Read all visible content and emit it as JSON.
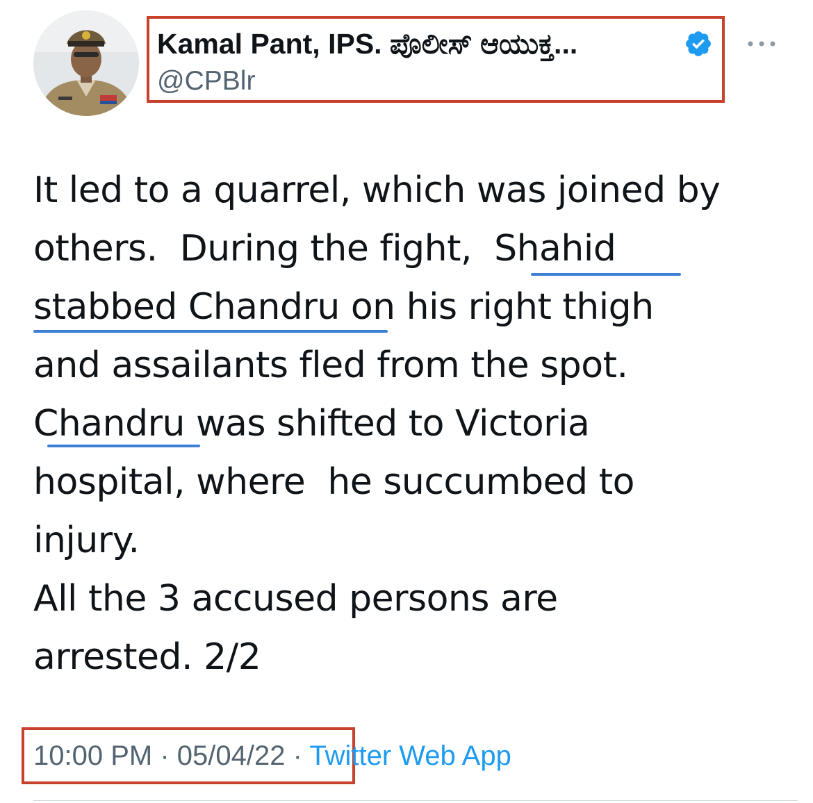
{
  "tweet": {
    "author": {
      "display_name": "Kamal Pant, IPS. ಪೊಲೀಸ್ ಆಯುಕ್ತ...",
      "handle": "@CPBlr",
      "verified": true,
      "avatar_icon": "police-officer-avatar"
    },
    "more_icon": "more-horizontal-icon",
    "lines": [
      "It led to a quarrel, which was joined by",
      "others.  During the fight,  Shahid",
      "stabbed Chandru on his right thigh",
      "and assailants fled from the spot.",
      "Chandru was shifted to Victoria",
      "hospital, where  he succumbed to",
      "injury.",
      "All the 3 accused persons are",
      "arrested. 2/2"
    ],
    "time": "10:00 PM",
    "separator": "·",
    "date": "05/04/22",
    "source": "Twitter Web App"
  },
  "colors": {
    "highlight_box": "#c8412b",
    "underline": "#3d7fd6",
    "link": "#1d9bf0",
    "muted_text": "#536471",
    "verified": "#1d9bf0"
  }
}
